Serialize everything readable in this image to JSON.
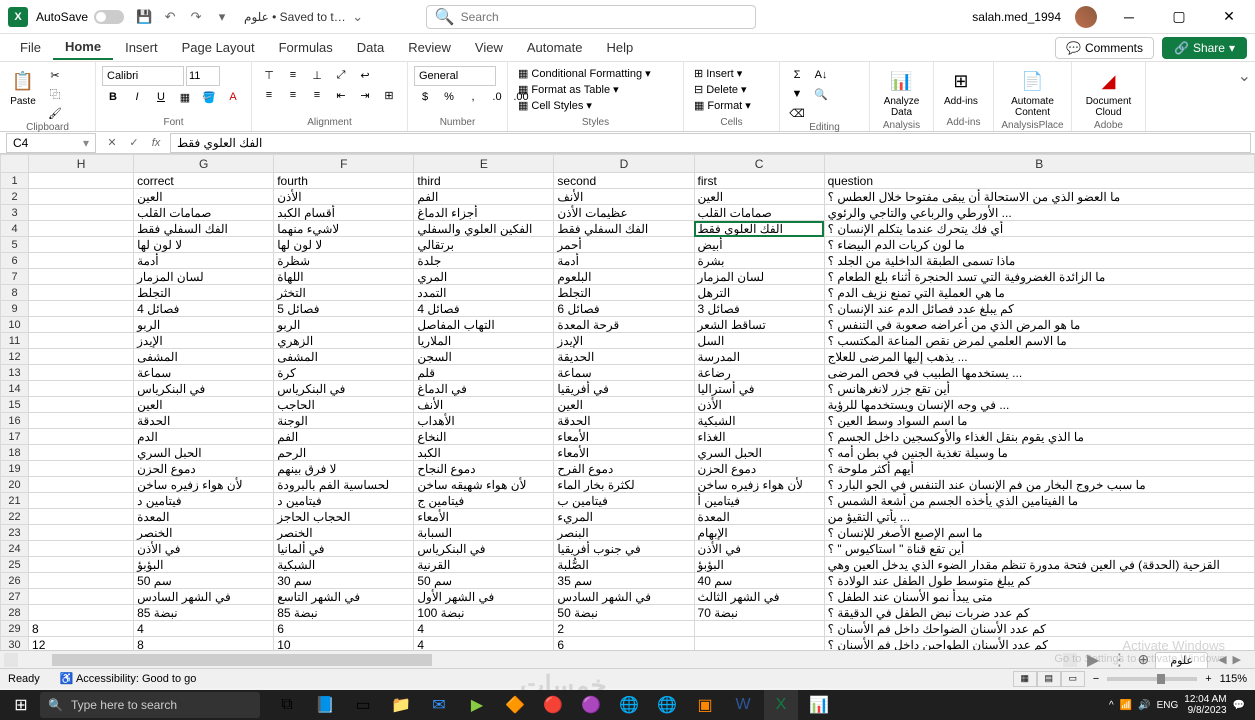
{
  "titlebar": {
    "app": "X",
    "autosave": "AutoSave",
    "docname": "علوم • Saved to t…",
    "search_placeholder": "Search",
    "user": "salah.med_1994"
  },
  "tabs": {
    "file": "File",
    "home": "Home",
    "insert": "Insert",
    "page_layout": "Page Layout",
    "formulas": "Formulas",
    "data": "Data",
    "review": "Review",
    "view": "View",
    "automate": "Automate",
    "help": "Help",
    "comments": "Comments",
    "share": "Share"
  },
  "ribbon": {
    "clipboard": {
      "label": "Clipboard",
      "paste": "Paste"
    },
    "font": {
      "label": "Font",
      "name": "Calibri",
      "size": "11"
    },
    "alignment": {
      "label": "Alignment"
    },
    "number": {
      "label": "Number",
      "format": "General"
    },
    "styles": {
      "label": "Styles",
      "cond": "Conditional Formatting",
      "table": "Format as Table",
      "cell": "Cell Styles"
    },
    "cells": {
      "label": "Cells",
      "insert": "Insert",
      "delete": "Delete",
      "format": "Format"
    },
    "editing": {
      "label": "Editing"
    },
    "analysis": {
      "label": "Analysis",
      "analyze": "Analyze Data"
    },
    "addins": {
      "label": "Add-ins",
      "btn": "Add-ins"
    },
    "analysisplace": {
      "label": "AnalysisPlace",
      "automate": "Automate Content"
    },
    "adobe": {
      "label": "Adobe",
      "doc": "Document Cloud"
    }
  },
  "namebox": "C4",
  "formula": "الفك العلوي فقط",
  "columns": [
    "H",
    "G",
    "F",
    "E",
    "D",
    "C",
    "B"
  ],
  "headers": {
    "H": "correct",
    "G": "fourth",
    "F": "third",
    "E": "second",
    "D": "first",
    "C": "question",
    "B": ""
  },
  "header_row": {
    "H": "",
    "G": "correct",
    "F": "fourth",
    "E": "third",
    "D": "second",
    "C": "first",
    "B": "question"
  },
  "rows": [
    {
      "n": 2,
      "H": "",
      "G": "العين",
      "F": "الأذن",
      "E": "الفم",
      "D": "الأنف",
      "C": "العين",
      "B": "ما العضو الذي من الاستحالة أن يبقى مفتوحا خلال العطس ؟"
    },
    {
      "n": 3,
      "H": "",
      "G": "صمامات القلب",
      "F": "أقسام الكبد",
      "E": "أجزاء الدماغ",
      "D": "عظيمات الأذن",
      "C": "صمامات القلب",
      "B": "الأورطي والرباعي والتاجي والرئوي ..."
    },
    {
      "n": 4,
      "H": "",
      "G": "الفك السفلي فقط",
      "F": "لاشيء منهما",
      "E": "الفكين العلوي والسفلي",
      "D": "الفك السفلي فقط",
      "C": "الفك العلوي فقط",
      "B": "أي فك يتحرك عندما يتكلم الإنسان ؟"
    },
    {
      "n": 5,
      "H": "",
      "G": "لا لون لها",
      "F": "لا لون لها",
      "E": "برتقالي",
      "D": "أحمر",
      "C": "أبيض",
      "B": "ما لون كريات الدم البيضاء ؟"
    },
    {
      "n": 6,
      "H": "",
      "G": "أدمة",
      "F": "شظرة",
      "E": "جلدة",
      "D": "أدمة",
      "C": "بشرة",
      "B": "ماذا تسمى الطبقة الداخلية من الجلد ؟"
    },
    {
      "n": 7,
      "H": "",
      "G": "لسان المزمار",
      "F": "اللهاة",
      "E": "المري",
      "D": "البلعوم",
      "C": "لسان المزمار",
      "B": "ما الزائدة الغضروفية التي تسد الحنجرة أثناء بلع الطعام ؟"
    },
    {
      "n": 8,
      "H": "",
      "G": "التجلط",
      "F": "التخثر",
      "E": "التمدد",
      "D": "التجلط",
      "C": "الترهل",
      "B": "ما هي العملية التي تمنع نزيف الدم ؟"
    },
    {
      "n": 9,
      "H": "",
      "G": "4 فصائل",
      "F": "5 فصائل",
      "E": "4 فصائل",
      "D": "6 فصائل",
      "C": "3 فصائل",
      "B": "كم يبلغ عدد فصائل الدم عند الإنسان ؟"
    },
    {
      "n": 10,
      "H": "",
      "G": "الربو",
      "F": "الربو",
      "E": "التهاب المفاصل",
      "D": "قرحة المعدة",
      "C": "تساقط الشعر",
      "B": "ما هو المرض الذي من أعراضه صعوبة في التنفس ؟"
    },
    {
      "n": 11,
      "H": "",
      "G": "الإيدز",
      "F": "الزهري",
      "E": "الملاريا",
      "D": "الإيدز",
      "C": "السل",
      "B": "ما الاسم العلمي لمرض نقص المناعة المكتسب ؟"
    },
    {
      "n": 12,
      "H": "",
      "G": "المشفى",
      "F": "المشفى",
      "E": "السجن",
      "D": "الحديقة",
      "C": "المدرسة",
      "B": "يذهب إليها المرضى للعلاج ..."
    },
    {
      "n": 13,
      "H": "",
      "G": "سماعة",
      "F": "كرة",
      "E": "قلم",
      "D": "سماعة",
      "C": "رضاعة",
      "B": "يستخدمها الطبيب في فحص المرضى ..."
    },
    {
      "n": 14,
      "H": "",
      "G": "في البنكرياس",
      "F": "في البنكرياس",
      "E": "في الدماغ",
      "D": "في أفريقيا",
      "C": "في أستراليا",
      "B": "أين تقع جزر لانغرهانس ؟"
    },
    {
      "n": 15,
      "H": "",
      "G": "العين",
      "F": "الحاجب",
      "E": "الأنف",
      "D": "العين",
      "C": "الأذن",
      "B": "في وجه الإنسان ويستخدمها للرؤية ..."
    },
    {
      "n": 16,
      "H": "",
      "G": "الحدقة",
      "F": "الوجنة",
      "E": "الأهداب",
      "D": "الحدقة",
      "C": "الشبكية",
      "B": "ما اسم السواد وسط العين ؟"
    },
    {
      "n": 17,
      "H": "",
      "G": "الدم",
      "F": "الفم",
      "E": "النخاع",
      "D": "الأمعاء",
      "C": "الغذاء",
      "B": "ما الذي يقوم بنقل الغذاء والأوكسجين داخل الجسم ؟"
    },
    {
      "n": 18,
      "H": "",
      "G": "الحبل السري",
      "F": "الرحم",
      "E": "الكبد",
      "D": "الأمعاء",
      "C": "الحبل السري",
      "B": "ما وسيلة تغذية الجنين في بطن أمه ؟"
    },
    {
      "n": 19,
      "H": "",
      "G": "دموع الحزن",
      "F": "لا فرق بينهم",
      "E": "دموع النجاح",
      "D": "دموع الفرح",
      "C": "دموع الحزن",
      "B": "أيهم أكثر ملوحة ؟"
    },
    {
      "n": 20,
      "H": "",
      "G": "لأن هواء زفيره ساخن",
      "F": "لحساسية الفم بالبرودة",
      "E": "لأن هواء شهيقه ساخن",
      "D": "لكثرة بخار الماء",
      "C": "لأن هواء زفيره ساخن",
      "B": "ما سبب خروج البخار من فم الإنسان عند التنفس في الجو البارد ؟"
    },
    {
      "n": 21,
      "H": "",
      "G": "فيتامين د",
      "F": "فيتامين د",
      "E": "فيتامين ج",
      "D": "فيتامين ب",
      "C": "فيتامين أ",
      "B": "ما الفيتامين الذي يأخذه الجسم من أشعة الشمس ؟"
    },
    {
      "n": 22,
      "H": "",
      "G": "المعدة",
      "F": "الحجاب الحاجز",
      "E": "الأمعاء",
      "D": "المريء",
      "C": "المعدة",
      "B": "يأتي التقيؤ من ..."
    },
    {
      "n": 23,
      "H": "",
      "G": "الخنصر",
      "F": "الخنصر",
      "E": "السبابة",
      "D": "البنصر",
      "C": "الإبهام",
      "B": "ما اسم الإصبع الأصغر للإنسان ؟"
    },
    {
      "n": 24,
      "H": "",
      "G": "في الأذن",
      "F": "في ألمانيا",
      "E": "في البنكرياس",
      "D": "في جنوب أفريقيا",
      "C": "في الأذن",
      "B": "أين تقع قناة \" استاكيوس \" ؟"
    },
    {
      "n": 25,
      "H": "",
      "G": "البؤبؤ",
      "F": "الشبكية",
      "E": "القرنية",
      "D": "الصُّلبة",
      "C": "البؤبؤ",
      "B": "القزحية (الحدقة) في العين فتحة مدورة تنظم مقدار الضوء الذي يدخل العين وهي"
    },
    {
      "n": 26,
      "H": "",
      "G": "50 سم",
      "F": "30 سم",
      "E": "50 سم",
      "D": "35 سم",
      "C": "40 سم",
      "B": "كم يبلغ متوسط طول الطفل عند الولادة ؟"
    },
    {
      "n": 27,
      "H": "",
      "G": "في الشهر السادس",
      "F": "في الشهر التاسع",
      "E": "في الشهر الأول",
      "D": "في الشهر السادس",
      "C": "في الشهر الثالث",
      "B": "متى يبدأ نمو الأسنان عند الطفل ؟"
    },
    {
      "n": 28,
      "H": "",
      "G": "85 نبضة",
      "F": "85 نبضة",
      "E": "100 نبضة",
      "D": "50 نبضة",
      "C": "70 نبضة",
      "B": "كم عدد ضربات نبض الطفل في الدقيقة ؟"
    },
    {
      "n": 29,
      "H": "8",
      "G": "4",
      "F": "6",
      "E": "4",
      "D": "2",
      "C": "",
      "B": "كم عدد الأسنان الضواحك داخل فم الأسنان ؟"
    },
    {
      "n": 30,
      "H": "12",
      "G": "8",
      "F": "10",
      "E": "4",
      "D": "6",
      "C": "",
      "B": "كم عدد الأسنان الطواحين داخل فم الأسنان ؟"
    }
  ],
  "sheet": {
    "name": "علوم"
  },
  "status": {
    "ready": "Ready",
    "access": "Accessibility: Good to go",
    "zoom": "115%"
  },
  "taskbar": {
    "search": "Type here to search",
    "time": "12:04 AM",
    "date": "9/8/2023"
  },
  "activate": {
    "l1": "Activate Windows",
    "l2": "Go to Settings to activate Windows"
  }
}
